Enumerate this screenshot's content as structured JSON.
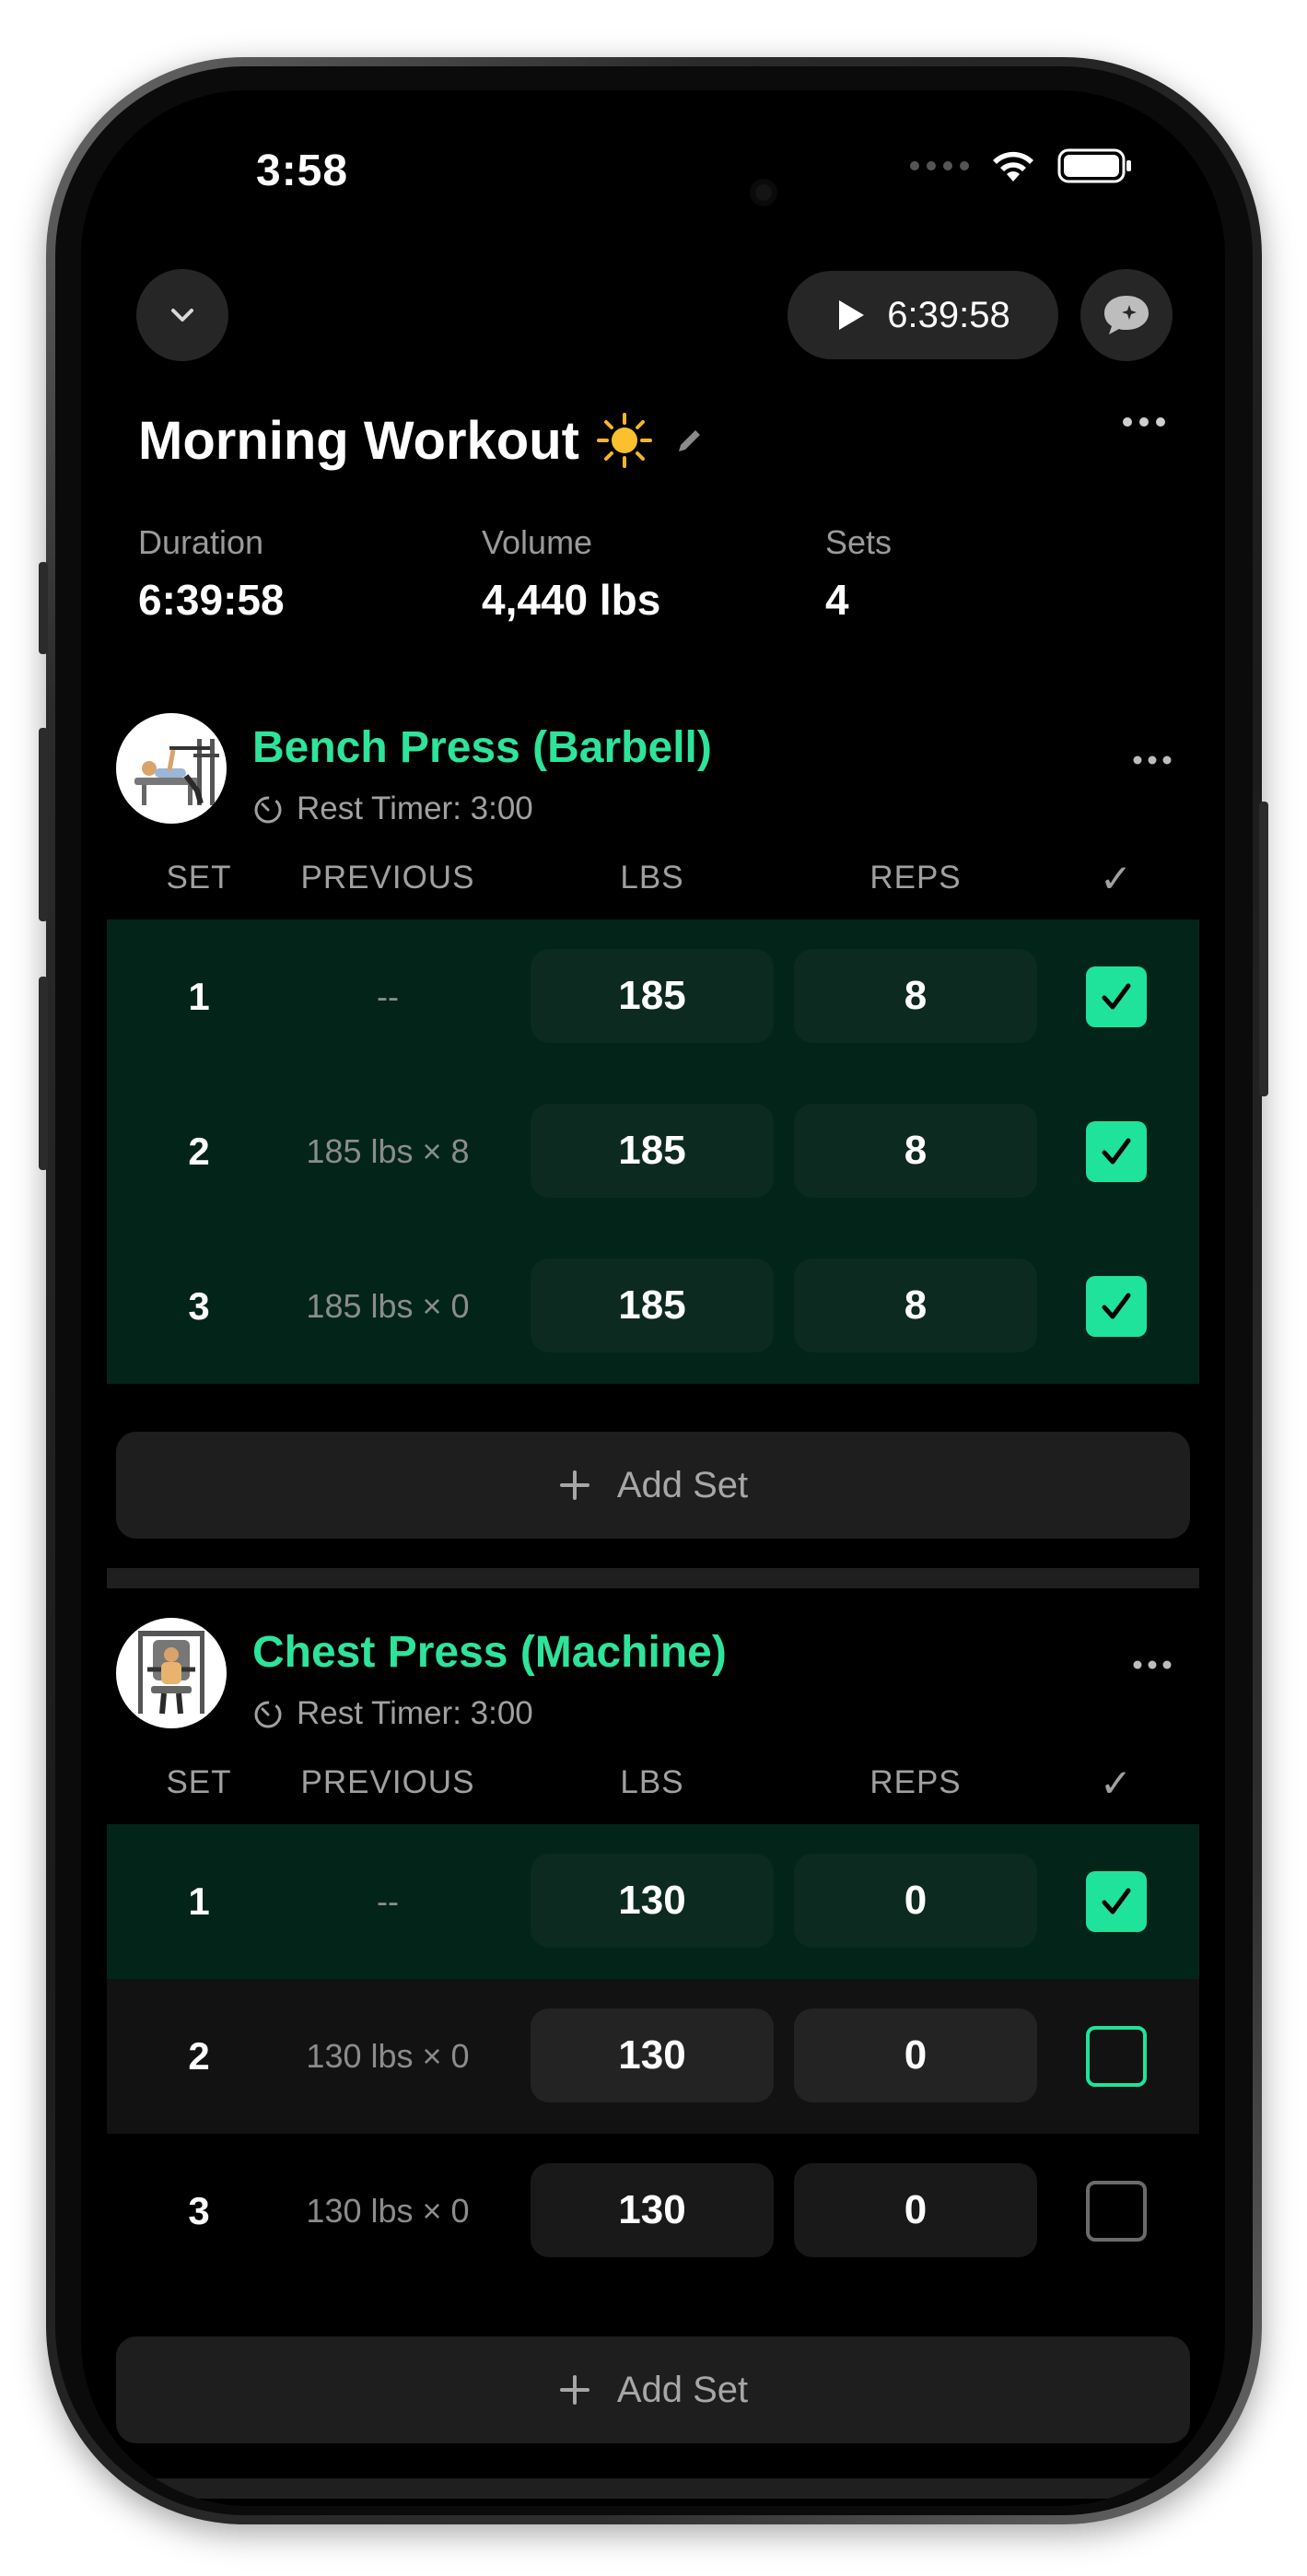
{
  "status_bar": {
    "time": "3:58"
  },
  "top_bar": {
    "timer": "6:39:58"
  },
  "workout": {
    "title": "Morning Workout"
  },
  "stats": [
    {
      "label": "Duration",
      "value": "6:39:58"
    },
    {
      "label": "Volume",
      "value": "4,440 lbs"
    },
    {
      "label": "Sets",
      "value": "4"
    }
  ],
  "columns": {
    "set": "SET",
    "previous": "PREVIOUS",
    "lbs": "LBS",
    "reps": "REPS",
    "check": "✓"
  },
  "exercises": [
    {
      "name": "Bench Press (Barbell)",
      "rest_timer": "Rest Timer: 3:00",
      "add_set_label": "Add Set",
      "sets": [
        {
          "set": "1",
          "previous": "--",
          "lbs": "185",
          "reps": "8",
          "completed": true
        },
        {
          "set": "2",
          "previous": "185 lbs × 8",
          "lbs": "185",
          "reps": "8",
          "completed": true
        },
        {
          "set": "3",
          "previous": "185 lbs × 0",
          "lbs": "185",
          "reps": "8",
          "completed": true
        }
      ]
    },
    {
      "name": "Chest Press (Machine)",
      "rest_timer": "Rest Timer: 3:00",
      "add_set_label": "Add Set",
      "sets": [
        {
          "set": "1",
          "previous": "--",
          "lbs": "130",
          "reps": "0",
          "completed": true
        },
        {
          "set": "2",
          "previous": "130 lbs × 0",
          "lbs": "130",
          "reps": "0",
          "completed": false
        },
        {
          "set": "3",
          "previous": "130 lbs × 0",
          "lbs": "130",
          "reps": "0",
          "completed": false
        }
      ]
    }
  ],
  "colors": {
    "accent": "#1fe39b",
    "completed_row": "#022419",
    "background": "#000000"
  },
  "icons": [
    "chevron-down-icon",
    "play-icon",
    "chat-sparkle-icon",
    "sun-emoji-icon",
    "pencil-icon",
    "more-icon",
    "stopwatch-icon",
    "plus-icon",
    "checkmark-icon"
  ]
}
